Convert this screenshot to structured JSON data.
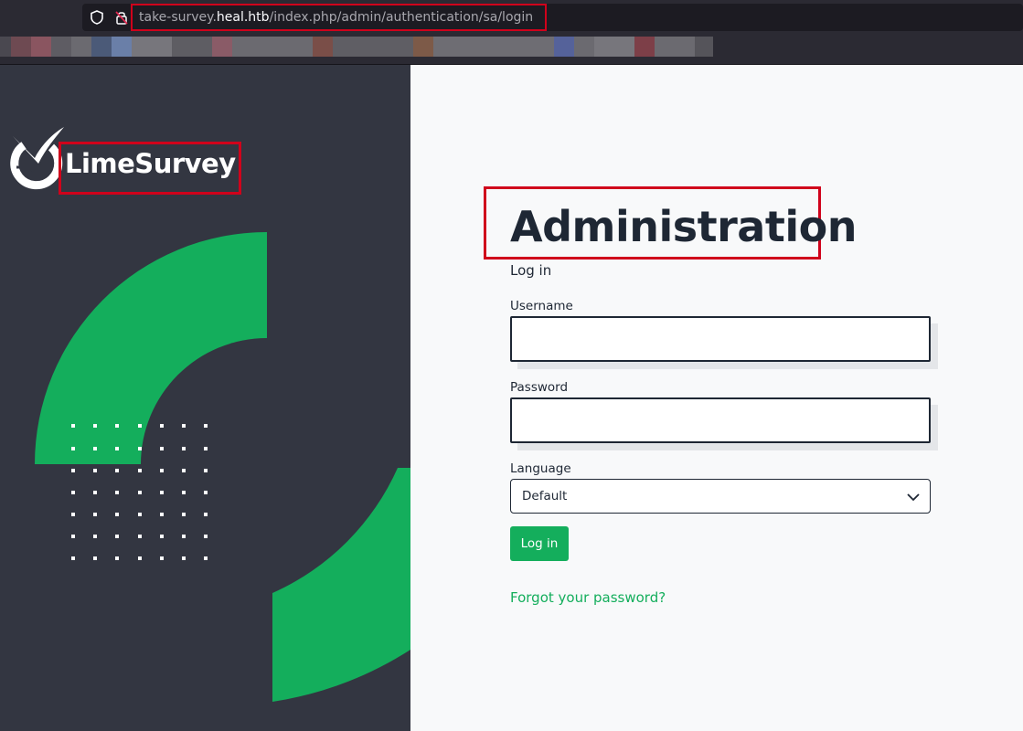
{
  "browser": {
    "url_prefix": "take-survey.",
    "url_domain": "heal.htb",
    "url_path": "/index.php/admin/authentication/sa/login",
    "icons": [
      "shield-icon",
      "lock-icon"
    ]
  },
  "brand": {
    "name": "LimeSurvey",
    "icon": "limesurvey-logo-icon",
    "accent": "#14ae5c",
    "panel_color": "#333641"
  },
  "form": {
    "title": "Administration",
    "subtitle": "Log in",
    "username_label": "Username",
    "username_value": "",
    "password_label": "Password",
    "password_value": "",
    "language_label": "Language",
    "language_value": "Default",
    "login_button": "Log in",
    "forgot_link": "Forgot your password?"
  },
  "annotations": {
    "highlight_color": "#d0021b"
  }
}
